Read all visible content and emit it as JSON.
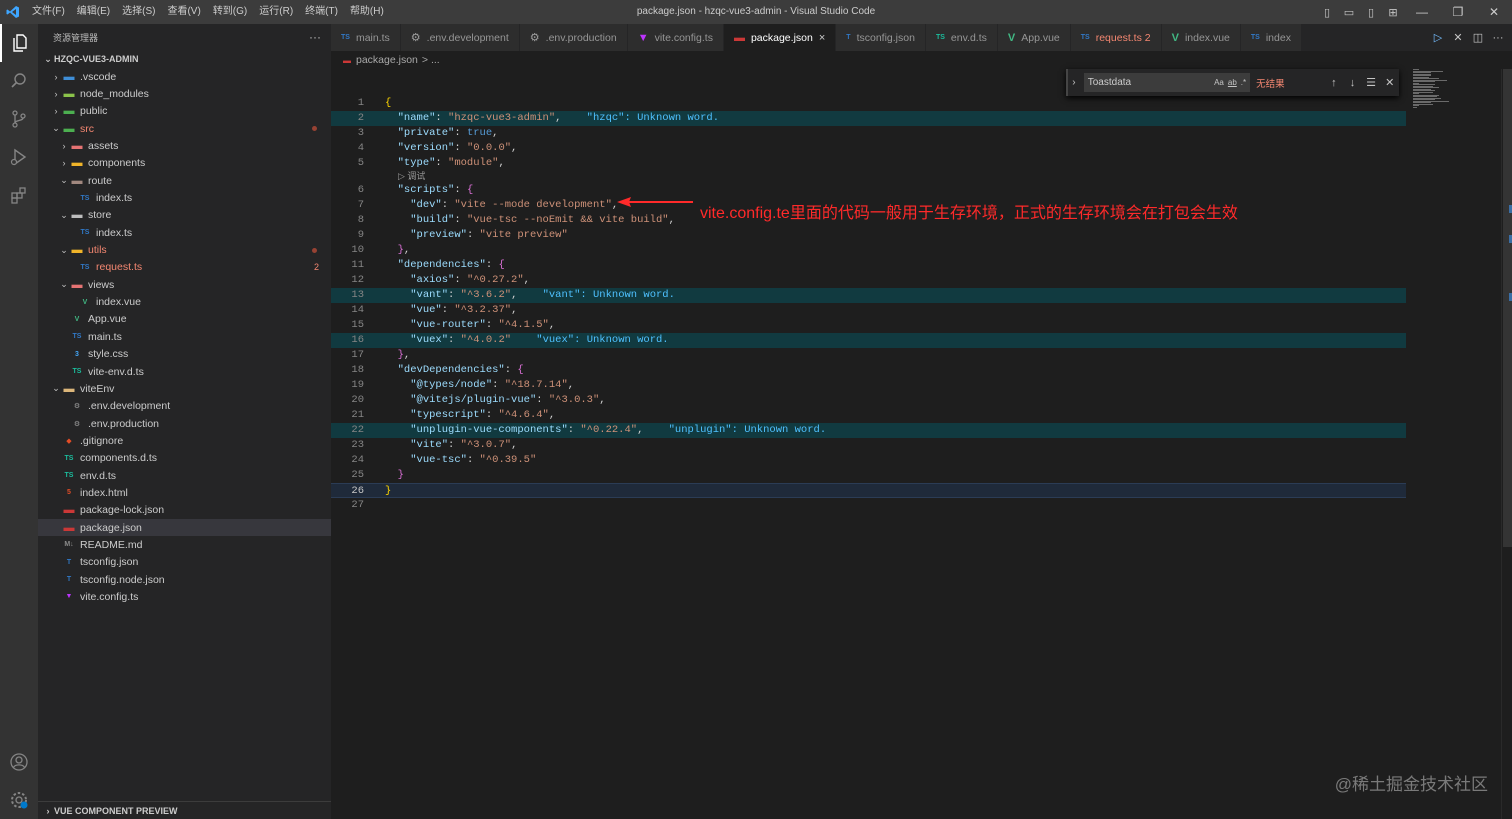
{
  "window": {
    "title": "package.json - hzqc-vue3-admin - Visual Studio Code",
    "menu": [
      "文件(F)",
      "编辑(E)",
      "选择(S)",
      "查看(V)",
      "转到(G)",
      "运行(R)",
      "终端(T)",
      "帮助(H)"
    ]
  },
  "sidebar": {
    "header": "资源管理器",
    "more": "···",
    "root": "HZQC-VUE3-ADMIN",
    "footer": "VUE COMPONENT PREVIEW",
    "items": [
      {
        "label": ".vscode",
        "depth": 0,
        "chev": "›",
        "icon": "folder-vscode-icon",
        "glyph": "▬",
        "color": "#3f8ed7"
      },
      {
        "label": "node_modules",
        "depth": 0,
        "chev": "›",
        "icon": "folder-node-icon",
        "glyph": "▬",
        "color": "#8bc34a"
      },
      {
        "label": "public",
        "depth": 0,
        "chev": "›",
        "icon": "folder-public-icon",
        "glyph": "▬",
        "color": "#4caf50"
      },
      {
        "label": "src",
        "depth": 0,
        "chev": "⌄",
        "icon": "folder-src-icon",
        "glyph": "▬",
        "color": "#4caf50",
        "red": true,
        "dot": true
      },
      {
        "label": "assets",
        "depth": 1,
        "chev": "›",
        "icon": "folder-assets-icon",
        "glyph": "▬",
        "color": "#e57373"
      },
      {
        "label": "components",
        "depth": 1,
        "chev": "›",
        "icon": "folder-components-icon",
        "glyph": "▬",
        "color": "#f0b429"
      },
      {
        "label": "route",
        "depth": 1,
        "chev": "⌄",
        "icon": "folder-route-icon",
        "glyph": "▬",
        "color": "#a1887f"
      },
      {
        "label": "index.ts",
        "depth": 2,
        "chev": "",
        "icon": "typescript-file-icon",
        "glyph": "TS",
        "color": "#3178c6"
      },
      {
        "label": "store",
        "depth": 1,
        "chev": "⌄",
        "icon": "folder-store-icon",
        "glyph": "▬",
        "color": "#bdbdbd"
      },
      {
        "label": "index.ts",
        "depth": 2,
        "chev": "",
        "icon": "typescript-file-icon",
        "glyph": "TS",
        "color": "#3178c6"
      },
      {
        "label": "utils",
        "depth": 1,
        "chev": "⌄",
        "icon": "folder-utils-icon",
        "glyph": "▬",
        "color": "#f0b429",
        "red": true,
        "dot": true
      },
      {
        "label": "request.ts",
        "depth": 2,
        "chev": "",
        "icon": "typescript-file-icon",
        "glyph": "TS",
        "color": "#3178c6",
        "red": true,
        "badge": "2"
      },
      {
        "label": "views",
        "depth": 1,
        "chev": "⌄",
        "icon": "folder-views-icon",
        "glyph": "▬",
        "color": "#e57373"
      },
      {
        "label": "index.vue",
        "depth": 2,
        "chev": "",
        "icon": "vue-file-icon",
        "glyph": "V",
        "color": "#41b883"
      },
      {
        "label": "App.vue",
        "depth": 1,
        "chev": "",
        "icon": "vue-file-icon",
        "glyph": "V",
        "color": "#41b883"
      },
      {
        "label": "main.ts",
        "depth": 1,
        "chev": "",
        "icon": "typescript-file-icon",
        "glyph": "TS",
        "color": "#3178c6"
      },
      {
        "label": "style.css",
        "depth": 1,
        "chev": "",
        "icon": "css-file-icon",
        "glyph": "3",
        "color": "#42a5f5"
      },
      {
        "label": "vite-env.d.ts",
        "depth": 1,
        "chev": "",
        "icon": "typescript-def-icon",
        "glyph": "TS",
        "color": "#1bbc9c"
      },
      {
        "label": "viteEnv",
        "depth": 0,
        "chev": "⌄",
        "icon": "folder-viteenv-icon",
        "glyph": "▬",
        "color": "#dcb67a"
      },
      {
        "label": ".env.development",
        "depth": 1,
        "chev": "",
        "icon": "gear-icon",
        "glyph": "⚙",
        "color": "#a0a0a0"
      },
      {
        "label": ".env.production",
        "depth": 1,
        "chev": "",
        "icon": "gear-icon",
        "glyph": "⚙",
        "color": "#a0a0a0"
      },
      {
        "label": ".gitignore",
        "depth": 0,
        "chev": "",
        "icon": "git-icon",
        "glyph": "◆",
        "color": "#e44d26"
      },
      {
        "label": "components.d.ts",
        "depth": 0,
        "chev": "",
        "icon": "typescript-def-icon",
        "glyph": "TS",
        "color": "#1bbc9c"
      },
      {
        "label": "env.d.ts",
        "depth": 0,
        "chev": "",
        "icon": "typescript-def-icon",
        "glyph": "TS",
        "color": "#1bbc9c"
      },
      {
        "label": "index.html",
        "depth": 0,
        "chev": "",
        "icon": "html-file-icon",
        "glyph": "5",
        "color": "#e44d26"
      },
      {
        "label": "package-lock.json",
        "depth": 0,
        "chev": "",
        "icon": "npm-icon",
        "glyph": "▬",
        "color": "#cb3837"
      },
      {
        "label": "package.json",
        "depth": 0,
        "chev": "",
        "icon": "npm-icon",
        "glyph": "▬",
        "color": "#cb3837",
        "selected": true
      },
      {
        "label": "README.md",
        "depth": 0,
        "chev": "",
        "icon": "markdown-icon",
        "glyph": "M↓",
        "color": "#8a8a8a"
      },
      {
        "label": "tsconfig.json",
        "depth": 0,
        "chev": "",
        "icon": "tsconfig-icon",
        "glyph": "T",
        "color": "#3178c6"
      },
      {
        "label": "tsconfig.node.json",
        "depth": 0,
        "chev": "",
        "icon": "tsconfig-icon",
        "glyph": "T",
        "color": "#3178c6"
      },
      {
        "label": "vite.config.ts",
        "depth": 0,
        "chev": "",
        "icon": "vite-icon",
        "glyph": "▼",
        "color": "#bd34fe"
      }
    ]
  },
  "tabs": [
    {
      "label": "main.ts",
      "icon": "typescript-file-icon",
      "glyph": "TS",
      "color": "#3178c6"
    },
    {
      "label": ".env.development",
      "icon": "gear-icon",
      "glyph": "⚙",
      "color": "#a0a0a0"
    },
    {
      "label": ".env.production",
      "icon": "gear-icon",
      "glyph": "⚙",
      "color": "#a0a0a0"
    },
    {
      "label": "vite.config.ts",
      "icon": "vite-icon",
      "glyph": "▼",
      "color": "#bd34fe"
    },
    {
      "label": "package.json",
      "icon": "npm-icon",
      "glyph": "▬",
      "color": "#cb3837",
      "active": true,
      "close": "×"
    },
    {
      "label": "tsconfig.json",
      "icon": "tsconfig-icon",
      "glyph": "T",
      "color": "#3178c6"
    },
    {
      "label": "env.d.ts",
      "icon": "typescript-def-icon",
      "glyph": "TS",
      "color": "#1bbc9c"
    },
    {
      "label": "App.vue",
      "icon": "vue-file-icon",
      "glyph": "V",
      "color": "#41b883"
    },
    {
      "label": "request.ts 2",
      "icon": "typescript-file-icon",
      "glyph": "TS",
      "color": "#3178c6",
      "red": true
    },
    {
      "label": "index.vue",
      "icon": "vue-file-icon",
      "glyph": "V",
      "color": "#41b883"
    },
    {
      "label": "index",
      "icon": "typescript-file-icon",
      "glyph": "TS",
      "color": "#3178c6"
    }
  ],
  "breadcrumb": {
    "file": "package.json",
    "rest": "> ..."
  },
  "find": {
    "value": "Toastdata",
    "result": "无结果",
    "match_case": "Aa",
    "whole_word": "ab",
    "regex": ".*"
  },
  "codelens": "▷ 调试",
  "code": [
    {
      "n": "1",
      "tokens": [
        [
          "b1",
          "{"
        ]
      ]
    },
    {
      "n": "2",
      "hl": true,
      "tokens": [
        [
          "p",
          "  "
        ],
        [
          "k",
          "\"name\""
        ],
        [
          "p",
          ": "
        ],
        [
          "s",
          "\"hzqc-vue3-admin\""
        ],
        [
          "p",
          ",    "
        ],
        [
          "diag",
          "\"hzqc\": Unknown word."
        ]
      ]
    },
    {
      "n": "3",
      "tokens": [
        [
          "p",
          "  "
        ],
        [
          "k",
          "\"private\""
        ],
        [
          "p",
          ": "
        ],
        [
          "bool",
          "true"
        ],
        [
          "p",
          ","
        ]
      ]
    },
    {
      "n": "4",
      "tokens": [
        [
          "p",
          "  "
        ],
        [
          "k",
          "\"version\""
        ],
        [
          "p",
          ": "
        ],
        [
          "s",
          "\"0.0.0\""
        ],
        [
          "p",
          ","
        ]
      ]
    },
    {
      "n": "5",
      "tokens": [
        [
          "p",
          "  "
        ],
        [
          "k",
          "\"type\""
        ],
        [
          "p",
          ": "
        ],
        [
          "s",
          "\"module\""
        ],
        [
          "p",
          ","
        ]
      ]
    },
    {
      "n": "6",
      "tokens": [
        [
          "p",
          "  "
        ],
        [
          "k",
          "\"scripts\""
        ],
        [
          "p",
          ": "
        ],
        [
          "b2",
          "{"
        ]
      ]
    },
    {
      "n": "7",
      "tokens": [
        [
          "p",
          "    "
        ],
        [
          "k",
          "\"dev\""
        ],
        [
          "p",
          ": "
        ],
        [
          "s",
          "\"vite --mode development\""
        ],
        [
          "p",
          ","
        ]
      ]
    },
    {
      "n": "8",
      "tokens": [
        [
          "p",
          "    "
        ],
        [
          "k",
          "\"build\""
        ],
        [
          "p",
          ": "
        ],
        [
          "s",
          "\"vue-tsc --noEmit && vite build\""
        ],
        [
          "p",
          ","
        ]
      ]
    },
    {
      "n": "9",
      "tokens": [
        [
          "p",
          "    "
        ],
        [
          "k",
          "\"preview\""
        ],
        [
          "p",
          ": "
        ],
        [
          "s",
          "\"vite preview\""
        ]
      ]
    },
    {
      "n": "10",
      "tokens": [
        [
          "p",
          "  "
        ],
        [
          "b2",
          "}"
        ],
        [
          "p",
          ","
        ]
      ]
    },
    {
      "n": "11",
      "tokens": [
        [
          "p",
          "  "
        ],
        [
          "k",
          "\"dependencies\""
        ],
        [
          "p",
          ": "
        ],
        [
          "b2",
          "{"
        ]
      ]
    },
    {
      "n": "12",
      "tokens": [
        [
          "p",
          "    "
        ],
        [
          "k",
          "\"axios\""
        ],
        [
          "p",
          ": "
        ],
        [
          "s",
          "\"^0.27.2\""
        ],
        [
          "p",
          ","
        ]
      ]
    },
    {
      "n": "13",
      "hl": true,
      "tokens": [
        [
          "p",
          "    "
        ],
        [
          "k",
          "\"vant\""
        ],
        [
          "p",
          ": "
        ],
        [
          "s",
          "\"^3.6.2\""
        ],
        [
          "p",
          ",    "
        ],
        [
          "diag",
          "\"vant\": Unknown word."
        ]
      ]
    },
    {
      "n": "14",
      "tokens": [
        [
          "p",
          "    "
        ],
        [
          "k",
          "\"vue\""
        ],
        [
          "p",
          ": "
        ],
        [
          "s",
          "\"^3.2.37\""
        ],
        [
          "p",
          ","
        ]
      ]
    },
    {
      "n": "15",
      "tokens": [
        [
          "p",
          "    "
        ],
        [
          "k",
          "\"vue-router\""
        ],
        [
          "p",
          ": "
        ],
        [
          "s",
          "\"^4.1.5\""
        ],
        [
          "p",
          ","
        ]
      ]
    },
    {
      "n": "16",
      "hl": true,
      "tokens": [
        [
          "p",
          "    "
        ],
        [
          "k",
          "\"vuex\""
        ],
        [
          "p",
          ": "
        ],
        [
          "s",
          "\"^4.0.2\""
        ],
        [
          "p",
          "    "
        ],
        [
          "diag",
          "\"vuex\": Unknown word."
        ]
      ]
    },
    {
      "n": "17",
      "tokens": [
        [
          "p",
          "  "
        ],
        [
          "b2",
          "}"
        ],
        [
          "p",
          ","
        ]
      ]
    },
    {
      "n": "18",
      "tokens": [
        [
          "p",
          "  "
        ],
        [
          "k",
          "\"devDependencies\""
        ],
        [
          "p",
          ": "
        ],
        [
          "b2",
          "{"
        ]
      ]
    },
    {
      "n": "19",
      "tokens": [
        [
          "p",
          "    "
        ],
        [
          "k",
          "\"@types/node\""
        ],
        [
          "p",
          ": "
        ],
        [
          "s",
          "\"^18.7.14\""
        ],
        [
          "p",
          ","
        ]
      ]
    },
    {
      "n": "20",
      "tokens": [
        [
          "p",
          "    "
        ],
        [
          "k",
          "\"@vitejs/plugin-vue\""
        ],
        [
          "p",
          ": "
        ],
        [
          "s",
          "\"^3.0.3\""
        ],
        [
          "p",
          ","
        ]
      ]
    },
    {
      "n": "21",
      "tokens": [
        [
          "p",
          "    "
        ],
        [
          "k",
          "\"typescript\""
        ],
        [
          "p",
          ": "
        ],
        [
          "s",
          "\"^4.6.4\""
        ],
        [
          "p",
          ","
        ]
      ]
    },
    {
      "n": "22",
      "hl": true,
      "tokens": [
        [
          "p",
          "    "
        ],
        [
          "k",
          "\"unplugin-vue-components\""
        ],
        [
          "p",
          ": "
        ],
        [
          "s",
          "\"^0.22.4\""
        ],
        [
          "p",
          ",    "
        ],
        [
          "diag",
          "\"unplugin\": Unknown word."
        ]
      ]
    },
    {
      "n": "23",
      "tokens": [
        [
          "p",
          "    "
        ],
        [
          "k",
          "\"vite\""
        ],
        [
          "p",
          ": "
        ],
        [
          "s",
          "\"^3.0.7\""
        ],
        [
          "p",
          ","
        ]
      ]
    },
    {
      "n": "24",
      "tokens": [
        [
          "p",
          "    "
        ],
        [
          "k",
          "\"vue-tsc\""
        ],
        [
          "p",
          ": "
        ],
        [
          "s",
          "\"^0.39.5\""
        ]
      ]
    },
    {
      "n": "25",
      "tokens": [
        [
          "p",
          "  "
        ],
        [
          "b2",
          "}"
        ]
      ]
    },
    {
      "n": "26",
      "cur": true,
      "tokens": [
        [
          "b1",
          "}"
        ]
      ]
    },
    {
      "n": "27",
      "tokens": []
    }
  ],
  "annotation": "vite.config.te里面的代码一般用于生存环境，正式的生存环境会在打包会生效",
  "watermark": "@稀土掘金技术社区",
  "colors": {
    "accent": "#007acc",
    "error": "#f48771",
    "annotation_red": "#ff2a2a"
  }
}
